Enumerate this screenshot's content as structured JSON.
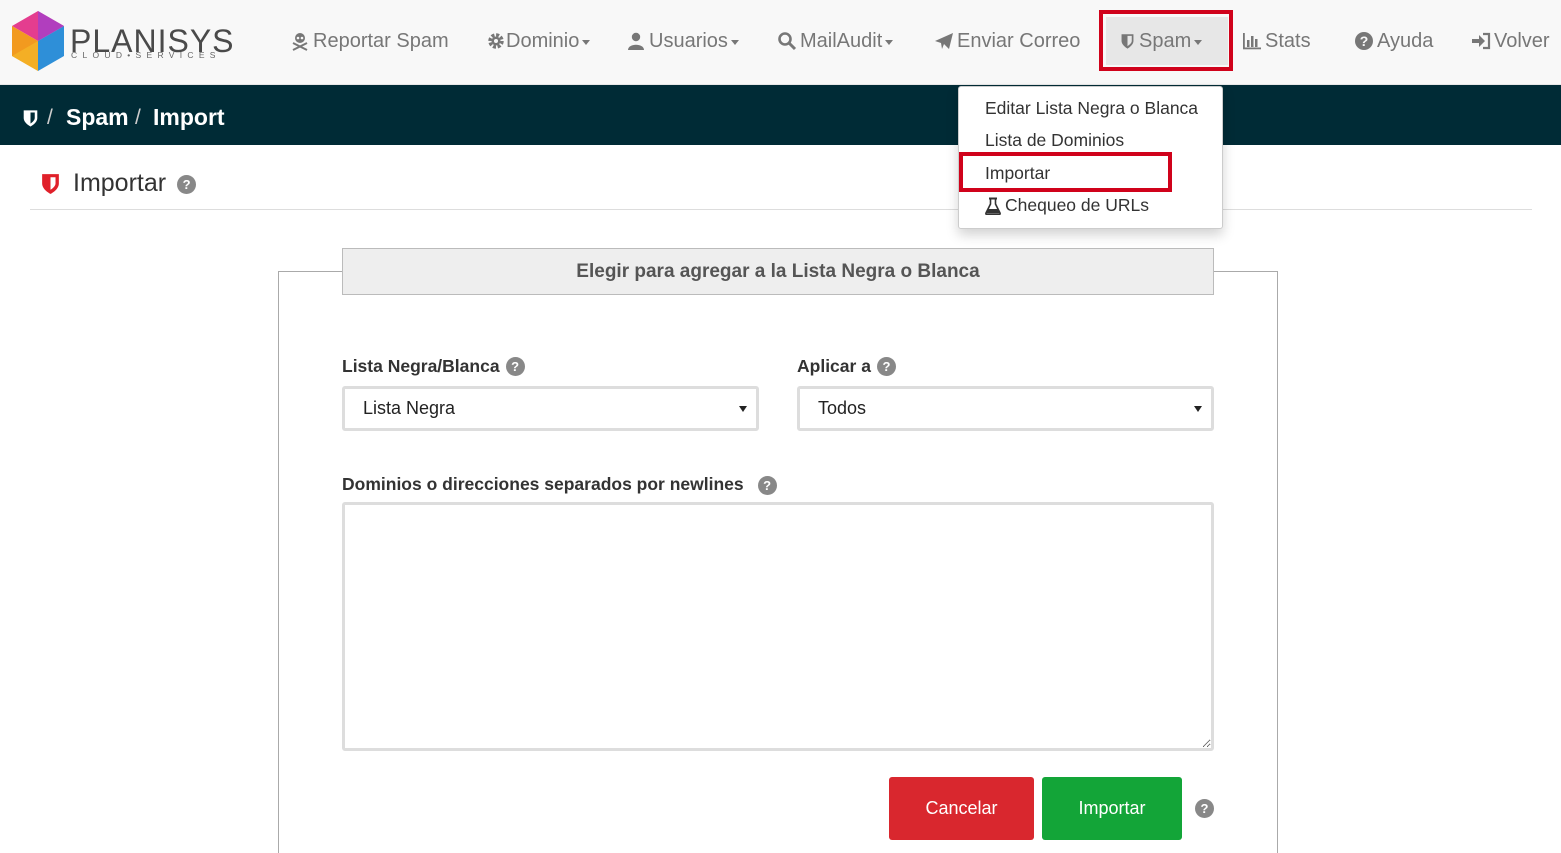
{
  "brand": {
    "name": "PLANISYS",
    "tagline": "CLOUD•SERVICES"
  },
  "nav": {
    "items": [
      {
        "label": "Reportar Spam",
        "icon": "skull-crossbones-icon",
        "dropdown": false
      },
      {
        "label": "Dominio",
        "icon": "gear-icon",
        "dropdown": true
      },
      {
        "label": "Usuarios",
        "icon": "user-icon",
        "dropdown": true
      },
      {
        "label": "MailAudit",
        "icon": "search-icon",
        "dropdown": true
      },
      {
        "label": "Enviar Correo",
        "icon": "paper-plane-icon",
        "dropdown": false
      },
      {
        "label": "Spam",
        "icon": "shield-icon",
        "dropdown": true,
        "active": true
      },
      {
        "label": "Stats",
        "icon": "bar-chart-icon",
        "dropdown": false
      },
      {
        "label": "Ayuda",
        "icon": "question-circle-icon",
        "dropdown": false
      },
      {
        "label": "Volver",
        "icon": "sign-in-icon",
        "dropdown": false
      }
    ]
  },
  "spam_menu": {
    "items": [
      {
        "label": "Editar Lista Negra o Blanca"
      },
      {
        "label": "Lista de Dominios"
      },
      {
        "label": "Importar",
        "highlighted": true
      },
      {
        "label": "Chequeo de URLs",
        "icon": "flask-icon"
      }
    ]
  },
  "breadcrumb": {
    "home_icon": "shield-icon",
    "separator": "/",
    "items": [
      "Spam",
      "Import"
    ]
  },
  "page": {
    "title": "Importar",
    "title_icon": "shield-icon"
  },
  "form": {
    "panel_title": "Elegir para agregar a la Lista Negra o Blanca",
    "list_label": "Lista Negra/Blanca",
    "list_value": "Lista Negra",
    "apply_label": "Aplicar a",
    "apply_value": "Todos",
    "domains_label": "Dominios o direcciones separados por newlines",
    "domains_value": "",
    "cancel_label": "Cancelar",
    "import_label": "Importar",
    "help_glyph": "?"
  },
  "colors": {
    "navbar_bg": "#f8f8f8",
    "breadcrumb_bg": "#002b36",
    "highlight": "#d0021b",
    "cancel": "#d9272e",
    "import": "#13a538",
    "shield_red": "#e0202a"
  }
}
